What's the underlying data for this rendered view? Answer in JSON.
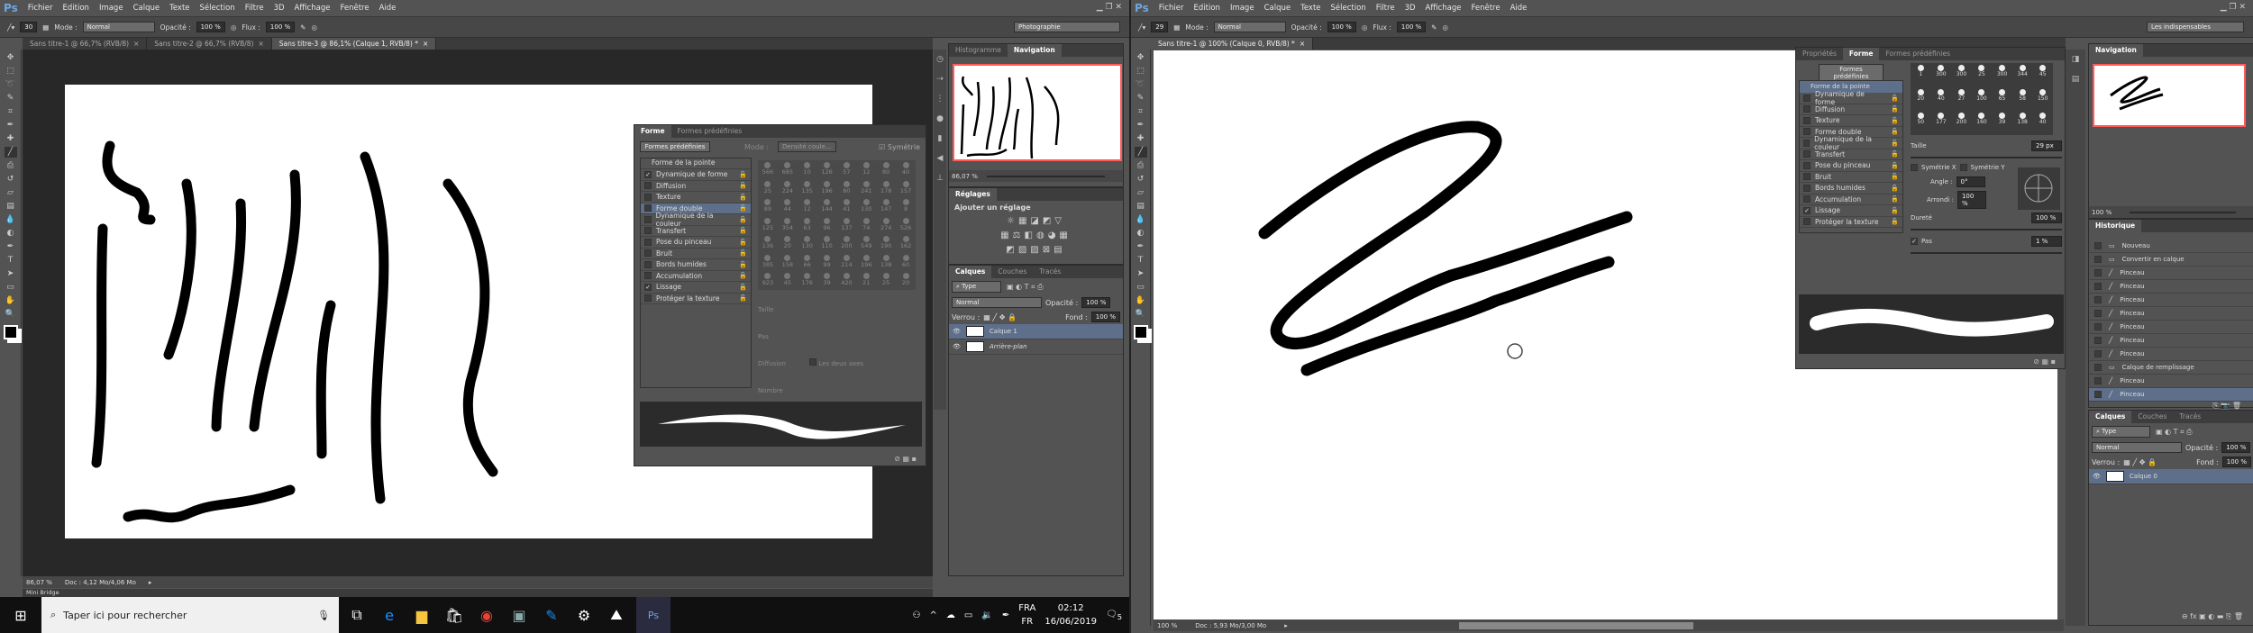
{
  "colors": {
    "accent": "#6fa6e0",
    "selection": "#5d6f8a",
    "nav_frame": "#ff5a5a"
  },
  "menu": [
    "Fichier",
    "Edition",
    "Image",
    "Calque",
    "Texte",
    "Sélection",
    "Filtre",
    "3D",
    "Affichage",
    "Fenêtre",
    "Aide"
  ],
  "left": {
    "options": {
      "size": "30",
      "mode_label": "Mode :",
      "mode": "Normal",
      "opacity_label": "Opacité :",
      "opacity": "100 %",
      "flux_label": "Flux :",
      "flux": "100 %",
      "workspace": "Photographie"
    },
    "tabs": [
      "Sans titre-1 @ 66,7% (RVB/8)",
      "Sans titre-2 @ 66,7% (RVB/8)",
      "Sans titre-3 @ 86,1% (Calque 1, RVB/8) *"
    ],
    "status": {
      "zoom": "86,07 %",
      "doc": "Doc : 4,12 Mo/4,06 Mo"
    },
    "minibridge": "Mini Bridge",
    "forme_panel": {
      "tabs": [
        "Forme",
        "Formes prédéfinies"
      ],
      "preset_button": "Formes prédéfinies",
      "mode_label": "Mode :",
      "mode": "Densité coule...",
      "symetrie": "Symétrie",
      "tip": "Forme de la pointe",
      "options": [
        {
          "label": "Dynamique de forme",
          "checked": true
        },
        {
          "label": "Diffusion",
          "checked": false
        },
        {
          "label": "Texture",
          "checked": false
        },
        {
          "label": "Forme double",
          "checked": false,
          "selected": true
        },
        {
          "label": "Dynamique de la couleur",
          "checked": false
        },
        {
          "label": "Transfert",
          "checked": false
        },
        {
          "label": "Pose du pinceau",
          "checked": false
        },
        {
          "label": "Bruit",
          "checked": false
        },
        {
          "label": "Bords humides",
          "checked": false
        },
        {
          "label": "Accumulation",
          "checked": false
        },
        {
          "label": "Lissage",
          "checked": true
        },
        {
          "label": "Protéger la texture",
          "checked": false
        }
      ],
      "brush_sizes": [
        "566",
        "685",
        "10",
        "126",
        "57",
        "12",
        "80",
        "40",
        "25",
        "224",
        "135",
        "196",
        "80",
        "241",
        "178",
        "157",
        "89",
        "44",
        "12",
        "144",
        "41",
        "130",
        "147",
        "8",
        "125",
        "354",
        "63",
        "96",
        "137",
        "74",
        "274",
        "526",
        "136",
        "20",
        "130",
        "110",
        "200",
        "549",
        "190",
        "162",
        "385",
        "158",
        "66",
        "99",
        "214",
        "196",
        "138",
        "60",
        "923",
        "45",
        "176",
        "39",
        "420",
        "21",
        "25",
        "20"
      ],
      "fields": {
        "taille": "Taille",
        "pas": "Pas",
        "diffusion": "Diffusion",
        "deux_axes": "Les deux axes",
        "nombre": "Nombre"
      }
    },
    "nav": {
      "tabs": [
        "Histogramme",
        "Navigation"
      ],
      "zoom": "86,07 %"
    },
    "reglages": {
      "tab": "Réglages",
      "title": "Ajouter un réglage"
    },
    "layers": {
      "tabs": [
        "Calques",
        "Couches",
        "Tracés"
      ],
      "filter": "Type",
      "blend": "Normal",
      "opacity_label": "Opacité :",
      "opacity": "100 %",
      "lock_label": "Verrou :",
      "fill_label": "Fond :",
      "fill": "100 %",
      "items": [
        {
          "name": "Calque 1",
          "selected": true
        },
        {
          "name": "Arrière-plan",
          "selected": false
        }
      ]
    }
  },
  "right": {
    "options": {
      "size": "29",
      "mode_label": "Mode :",
      "mode": "Normal",
      "opacity_label": "Opacité :",
      "opacity": "100 %",
      "flux_label": "Flux :",
      "flux": "100 %",
      "workspace": "Les indispensables"
    },
    "tabs": [
      "Sans titre-1 @ 100% (Calque 0, RVB/8) *"
    ],
    "status": {
      "zoom": "100 %",
      "doc": "Doc : 5,93 Mo/3,00 Mo"
    },
    "forme_panel": {
      "tabs": [
        "Propriétés",
        "Forme",
        "Formes prédéfinies"
      ],
      "preset_button": "Formes prédéfinies",
      "tip": "Forme de la pointe",
      "options": [
        {
          "label": "Dynamique de forme",
          "checked": false
        },
        {
          "label": "Diffusion",
          "checked": false
        },
        {
          "label": "Texture",
          "checked": false
        },
        {
          "label": "Forme double",
          "checked": false
        },
        {
          "label": "Dynamique de la couleur",
          "checked": false
        },
        {
          "label": "Transfert",
          "checked": false
        },
        {
          "label": "Pose du pinceau",
          "checked": false
        },
        {
          "label": "Bruit",
          "checked": false
        },
        {
          "label": "Bords humides",
          "checked": false
        },
        {
          "label": "Accumulation",
          "checked": false
        },
        {
          "label": "Lissage",
          "checked": true
        },
        {
          "label": "Protéger la texture",
          "checked": false
        }
      ],
      "brush_sizes": [
        "1",
        "300",
        "300",
        "25",
        "300",
        "344",
        "45",
        "20",
        "40",
        "27",
        "100",
        "65",
        "58",
        "150",
        "50",
        "177",
        "200",
        "160",
        "39",
        "138",
        "40"
      ],
      "taille_label": "Taille",
      "taille": "29 px",
      "sym_x": "Symétrie X",
      "sym_y": "Symétrie Y",
      "angle_label": "Angle :",
      "angle": "0°",
      "arrondi_label": "Arrondi :",
      "arrondi": "100 %",
      "durete_label": "Dureté",
      "durete": "100 %",
      "pas_label": "Pas",
      "pas": "1 %"
    },
    "nav": {
      "tab": "Navigation",
      "zoom": "100 %"
    },
    "history": {
      "tab": "Historique",
      "items": [
        {
          "label": "Nouveau",
          "icon": "doc"
        },
        {
          "label": "Convertir en calque",
          "icon": "doc"
        },
        {
          "label": "Pinceau",
          "icon": "brush"
        },
        {
          "label": "Pinceau",
          "icon": "brush"
        },
        {
          "label": "Pinceau",
          "icon": "brush"
        },
        {
          "label": "Pinceau",
          "icon": "brush"
        },
        {
          "label": "Pinceau",
          "icon": "brush"
        },
        {
          "label": "Pinceau",
          "icon": "brush"
        },
        {
          "label": "Pinceau",
          "icon": "brush"
        },
        {
          "label": "Calque de remplissage",
          "icon": "doc"
        },
        {
          "label": "Pinceau",
          "icon": "brush"
        },
        {
          "label": "Pinceau",
          "icon": "brush",
          "selected": true
        }
      ]
    },
    "layers": {
      "tabs": [
        "Calques",
        "Couches",
        "Tracés"
      ],
      "filter": "Type",
      "blend": "Normal",
      "opacity_label": "Opacité :",
      "opacity": "100 %",
      "lock_label": "Verrou :",
      "fill_label": "Fond :",
      "fill": "100 %",
      "items": [
        {
          "name": "Calque 0",
          "selected": true
        }
      ]
    }
  },
  "taskbar": {
    "search_placeholder": "Taper ici pour rechercher",
    "lang_top": "FRA",
    "lang_bottom": "FR",
    "time": "02:12",
    "date": "16/06/2019",
    "notifications": "5"
  }
}
